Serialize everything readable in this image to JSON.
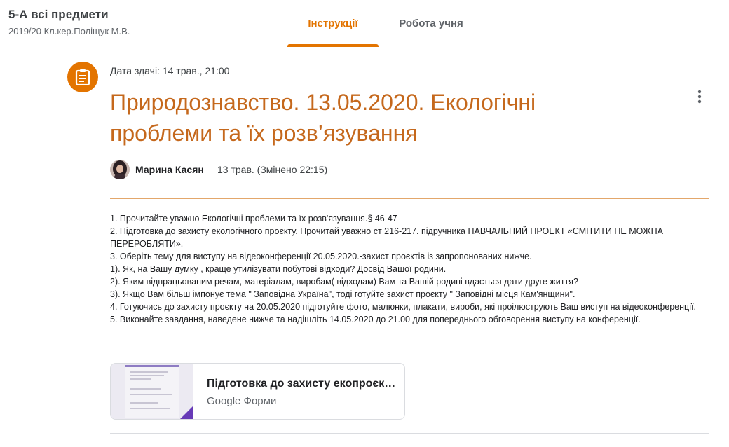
{
  "header": {
    "class_name": "5-А всі предмети",
    "class_subtitle": "2019/20 Кл.кер.Поліщук М.В.",
    "tabs": [
      {
        "label": "Інструкції",
        "active": true
      },
      {
        "label": "Робота учня",
        "active": false
      }
    ]
  },
  "assignment": {
    "icon": "assignment-icon",
    "due": "Дата здачі: 14 трав., 21:00",
    "title": "Природознавство. 13.05.2020. Екологічні проблеми та їх розв’язування",
    "author": "Марина Касян",
    "posted": "13 трав. (Змінено 22:15)",
    "instructions": [
      "1. Прочитайте уважно Екологічні проблеми та їх розв'язування.§ 46-47",
      "2. Підготовка до захисту екологічного проєкту. Прочитай уважно ст 216-217. підручника НАВЧАЛЬНИЙ ПРОЕКТ «СМІТИТИ НЕ МОЖНА ПЕРЕРОБЛЯТИ».",
      "3. Оберіть тему для виступу на відеоконференції 20.05.2020.-захист проєктів із запропонованих нижче.",
      "1). Як, на Вашу думку , краще утилізувати побутові відходи? Досвід Вашої родини.",
      "2). Яким відпрацьованим речам, матеріалам, виробам( відходам) Вам та Вашій родині вдається дати друге життя?",
      "3). Якщо Вам більш імпонує тема \" Заповідна Україна\", тоді готуйте захист проєкту \" Заповідні місця Кам'янщини\".",
      "4. Готуючись до захисту проєкту на 20.05.2020 підготуйте фото, малюнки, плакати, вироби, які проілюструють Ваш виступ на відеоконференції.",
      "5. Виконайте завдання, наведене нижче та надішліть 14.05.2020 до 21.00 для попереднього обговорення виступу на конференції."
    ],
    "attachment": {
      "title": "Підготовка до захисту екопроєкту",
      "type": "Google Форми"
    }
  },
  "colors": {
    "accent": "#e37400",
    "title": "#c5681c",
    "forms_purple": "#673ab7"
  }
}
